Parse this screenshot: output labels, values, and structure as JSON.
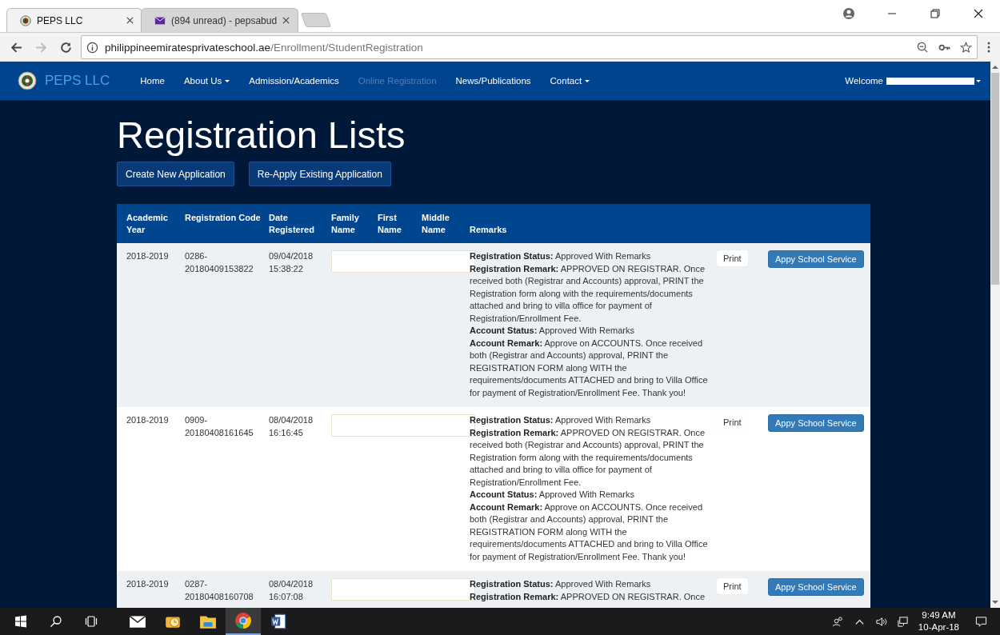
{
  "browser": {
    "tabs": [
      {
        "title": "PEPS LLC",
        "kind": "site",
        "selected": true
      },
      {
        "title": "(894 unread) - pepsabud",
        "kind": "mail",
        "selected": false
      }
    ],
    "url_host": "philippineemiratesprivateschool.ae",
    "url_path": "/Enrollment/StudentRegistration"
  },
  "navbar": {
    "brand": "PEPS LLC",
    "items": [
      {
        "label": "Home",
        "dropdown": false,
        "selected": false
      },
      {
        "label": "About Us",
        "dropdown": true,
        "selected": false
      },
      {
        "label": "Admission/Academics",
        "dropdown": false,
        "selected": false
      },
      {
        "label": "Online Registration",
        "dropdown": false,
        "selected": true
      },
      {
        "label": "News/Publications",
        "dropdown": false,
        "selected": false
      },
      {
        "label": "Contact",
        "dropdown": true,
        "selected": false
      }
    ],
    "welcome": "Welcome"
  },
  "page": {
    "title": "Registration Lists",
    "buttons": [
      "Create New Application",
      "Re-Apply Existing Application"
    ],
    "table": {
      "columns": [
        "Academic Year",
        "Registration Code",
        "Date Registered",
        "Family Name",
        "First Name",
        "Middle Name",
        "Remarks"
      ],
      "rows": [
        {
          "academic_year": "2018-2019",
          "registration_code": "0286-20180409153822",
          "date_registered": "09/04/2018 15:38:22",
          "print": "Print",
          "service": "Appy School Service",
          "remarks": [
            "**Registration Status:** Approved With Remarks",
            "**Registration Remark:** APPROVED ON REGISTRAR. Once",
            "received both (Registrar and Accounts) approval, PRINT the",
            "Registration form along with the requirements/documents",
            "attached and bring to villa office for payment of",
            "Registration/Enrollment Fee.",
            "**Account Status:** Approved With Remarks",
            "**Account Remark:** Approve on ACCOUNTS. Once received",
            "both (Registrar and Accounts) approval, PRINT the",
            "REGISTRATION FORM along WITH the",
            "requirements/documents ATTACHED and bring to Villa Office",
            "for payment of Registration/Enrollment Fee. Thank you!"
          ]
        },
        {
          "academic_year": "2018-2019",
          "registration_code": "0909-20180408161645",
          "date_registered": "08/04/2018 16:16:45",
          "print": "Print",
          "service": "Appy School Service",
          "remarks": [
            "**Registration Status:** Approved With Remarks",
            "**Registration Remark:** APPROVED ON REGISTRAR. Once",
            "received both (Registrar and Accounts) approval, PRINT the",
            "Registration form along with the requirements/documents",
            "attached and bring to villa office for payment of",
            "Registration/Enrollment Fee.",
            "**Account Status:** Approved With Remarks",
            "**Account Remark:** Approve on ACCOUNTS. Once received",
            "both (Registrar and Accounts) approval, PRINT the",
            "REGISTRATION FORM along WITH the",
            "requirements/documents ATTACHED and bring to Villa Office",
            "for payment of Registration/Enrollment Fee. Thank you!"
          ]
        },
        {
          "academic_year": "2018-2019",
          "registration_code": "0287-20180408160708",
          "date_registered": "08/04/2018 16:07:08",
          "print": "Print",
          "service": "Appy School Service",
          "remarks": [
            "**Registration Status:** Approved With Remarks",
            "**Registration Remark:** APPROVED ON REGISTRAR. Once"
          ]
        }
      ]
    }
  },
  "taskbar": {
    "apps": [
      {
        "kind": "mail",
        "selected": false
      },
      {
        "kind": "outlook",
        "selected": false
      },
      {
        "kind": "explorer",
        "selected": false
      },
      {
        "kind": "chrome",
        "selected": true
      },
      {
        "kind": "word",
        "selected": false
      }
    ],
    "time": "9:49 AM",
    "date": "10-Apr-18"
  }
}
